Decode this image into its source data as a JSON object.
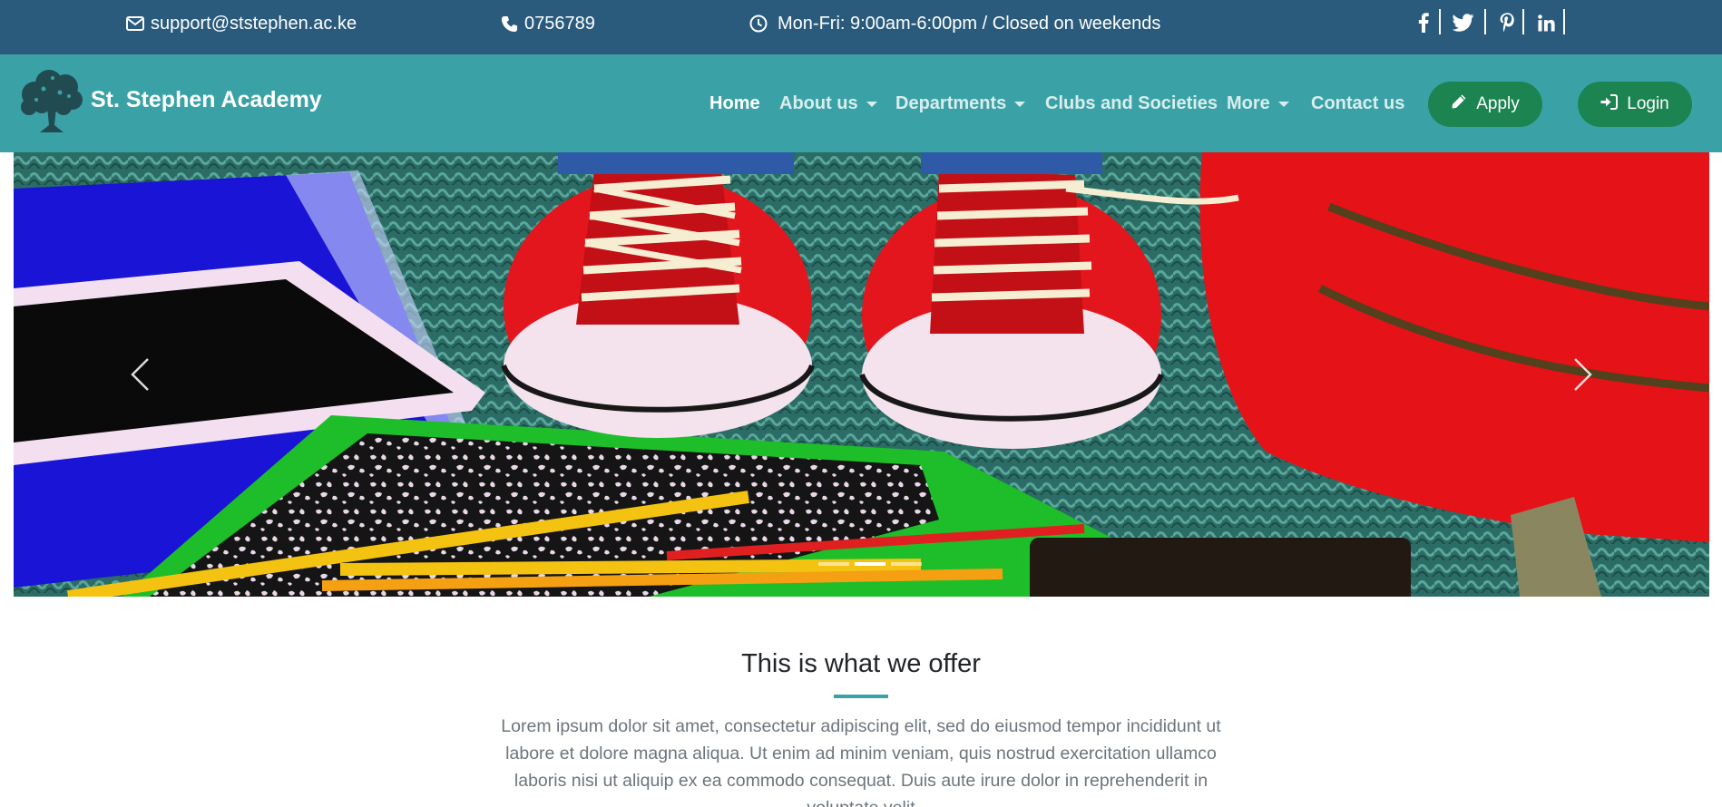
{
  "topbar": {
    "email": "support@ststephen.ac.ke",
    "phone": "0756789",
    "hours": "Mon-Fri: 9:00am-6:00pm / Closed on weekends",
    "icons": [
      "envelope-icon",
      "phone-icon",
      "clock-icon"
    ],
    "social": [
      "facebook-icon",
      "twitter-icon",
      "pinterest-icon",
      "linkedin-icon"
    ],
    "background": "#2a5b7c"
  },
  "navbar": {
    "brand": "St. Stephen Academy",
    "background": "#3aa2a6",
    "items": [
      {
        "label": "Home",
        "active": true
      },
      {
        "label": "About us",
        "dropdown": true
      },
      {
        "label": "Departments",
        "dropdown": true
      },
      {
        "label": "Clubs and Societies"
      },
      {
        "label": "More",
        "dropdown": true
      },
      {
        "label": "Contact us"
      }
    ],
    "apply_label": "Apply",
    "login_label": "Login",
    "button_color": "#1b8451"
  },
  "hero": {
    "slides": 3,
    "active_slide": 2,
    "controls": [
      "chevron-left-icon",
      "chevron-right-icon"
    ]
  },
  "offer": {
    "title": "This is what we offer",
    "text": "Lorem ipsum dolor sit amet, consectetur adipiscing elit, sed do eiusmod tempor incididunt ut labore et dolore magna aliqua. Ut enim ad minim veniam, quis nostrud exercitation ullamco laboris nisi ut aliquip ex ea commodo consequat. Duis aute irure dolor in reprehenderit in voluptate velit"
  }
}
